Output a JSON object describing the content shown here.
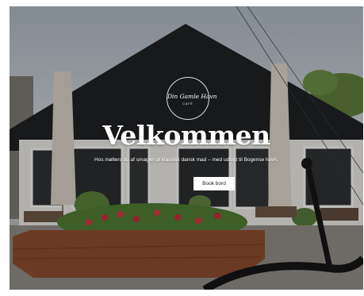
{
  "hero": {
    "logo_text": "Din Gamle Havn",
    "logo_subtext": "CAFÉ",
    "title": "Velkommen",
    "subtitle": "Hos møllers du af smagen af klassisk dansk mad – med udsigt til Bogense havn.",
    "cta_label": "Book bord"
  }
}
